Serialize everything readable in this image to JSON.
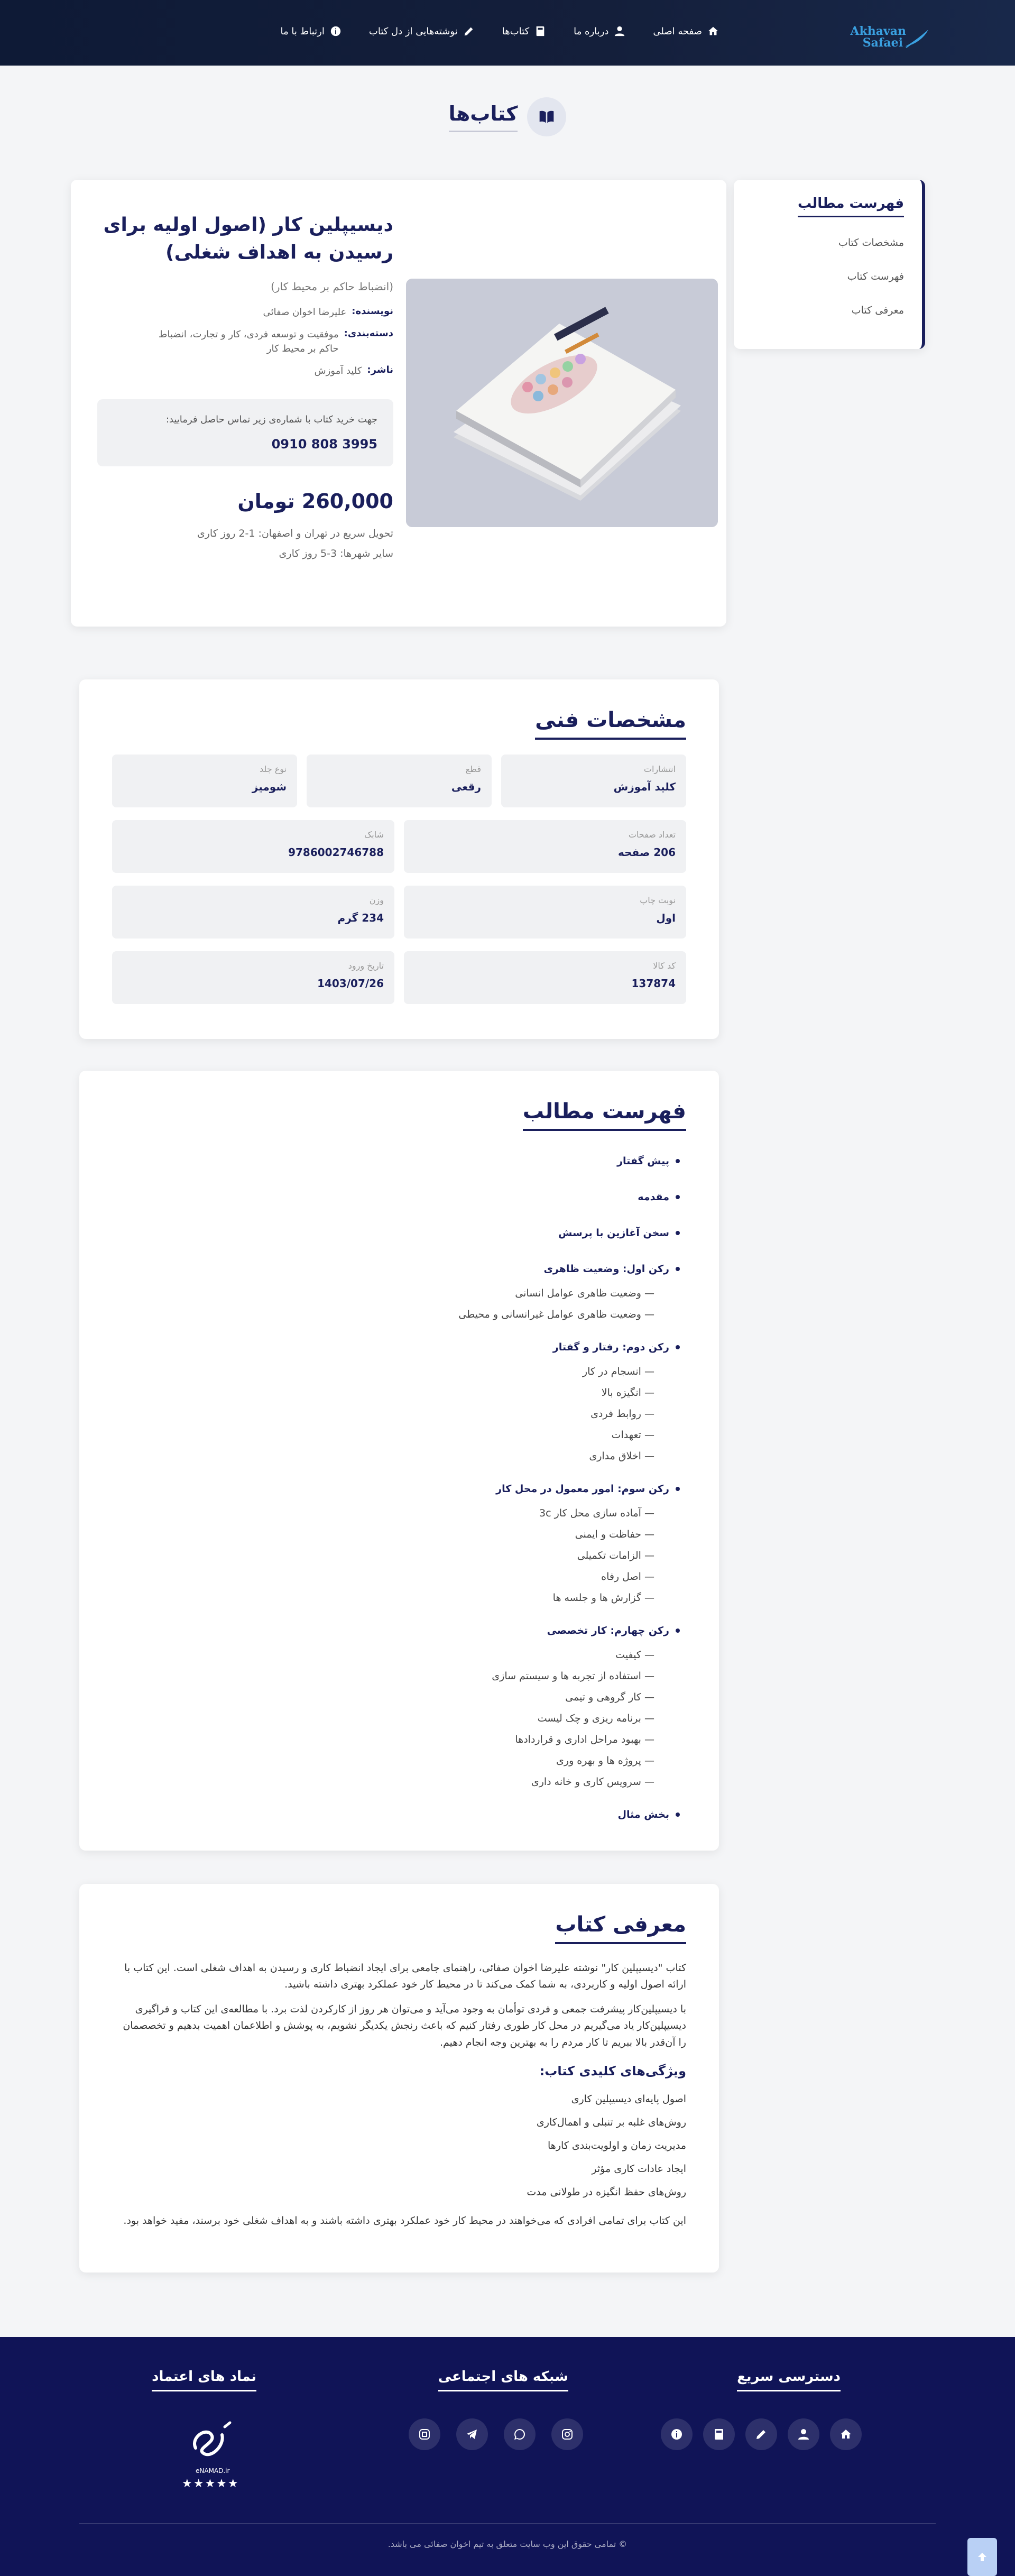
{
  "header": {
    "logo_line1": "Akhavan",
    "logo_line2": "Safaei",
    "nav": [
      {
        "label": "صفحه اصلی",
        "icon": "home-icon"
      },
      {
        "label": "درباره ما",
        "icon": "user-icon"
      },
      {
        "label": "کتاب‌ها",
        "icon": "book-icon"
      },
      {
        "label": "نوشته‌هایی از دل کتاب",
        "icon": "pen-icon"
      },
      {
        "label": "ارتباط با ما",
        "icon": "info-icon"
      }
    ]
  },
  "page_title": "کتاب‌ها",
  "sidebar_toc": {
    "title": "فهرست مطالب",
    "links": [
      "مشخصات کتاب",
      "فهرست کتاب",
      "معرفی کتاب"
    ]
  },
  "book": {
    "title": "دیسیپلین کار (اصول اولیه برای رسیدن به اهداف شغلی)",
    "subtitle": "(انضباط حاکم بر محیط کار)",
    "author_label": "نویسنده:",
    "author": "علیرضا اخوان صفائی",
    "category_label": "دسته‌بندی:",
    "category": "موفقیت و توسعه فردی، کار و تجارت، انضباط حاکم بر محیط کار",
    "publisher_label": "ناشر:",
    "publisher": "کلید آموزش",
    "contact_text": "جهت خرید کتاب با شماره‌ی زیر تماس حاصل فرمایید:",
    "phone": "0910 808 3995",
    "price": "260,000 تومان",
    "delivery_1": "تحویل سریع در تهران و اصفهان: 1-2 روز کاری",
    "delivery_2": "سایر شهرها: 3-5 روز کاری"
  },
  "specs": {
    "title": "مشخصات فنی",
    "items": [
      {
        "label": "انتشارات",
        "value": "کلید آموزش"
      },
      {
        "label": "قطع",
        "value": "رقعی"
      },
      {
        "label": "نوع جلد",
        "value": "شومیز"
      },
      {
        "label": "تعداد صفحات",
        "value": "206 صفحه"
      },
      {
        "label": "شابک",
        "value": "9786002746788"
      },
      {
        "label": "نوبت چاپ",
        "value": "اول"
      },
      {
        "label": "وزن",
        "value": "234 گرم"
      },
      {
        "label": "کد کالا",
        "value": "137874"
      },
      {
        "label": "تاریخ ورود",
        "value": "1403/07/26"
      }
    ]
  },
  "contents": {
    "title": "فهرست مطالب",
    "items": [
      {
        "text": "پیش گفتار",
        "level": 0
      },
      {
        "text": "مقدمه",
        "level": 0
      },
      {
        "text": "سخن آغازین با پرسش",
        "level": 0
      },
      {
        "text": "رکن اول: وضعیت ظاهری",
        "level": 0
      },
      {
        "text": "— وضعیت ظاهری عوامل انسانی",
        "level": 1
      },
      {
        "text": "— وضعیت ظاهری عوامل غیرانسانی و محیطی",
        "level": 1
      },
      {
        "text": "رکن دوم: رفتار و گفتار",
        "level": 0
      },
      {
        "text": "— انسجام در کار",
        "level": 1
      },
      {
        "text": "— انگیزه بالا",
        "level": 1
      },
      {
        "text": "— روابط فردی",
        "level": 1
      },
      {
        "text": "— تعهدات",
        "level": 1
      },
      {
        "text": "— اخلاق مداری",
        "level": 1
      },
      {
        "text": "رکن سوم: امور معمول در محل کار",
        "level": 0
      },
      {
        "text": "— آماده سازی محل کار 3c",
        "level": 1
      },
      {
        "text": "— حفاظت و ایمنی",
        "level": 1
      },
      {
        "text": "— الزامات تکمیلی",
        "level": 1
      },
      {
        "text": "— اصل رفاه",
        "level": 1
      },
      {
        "text": "— گزارش ها و جلسه ها",
        "level": 1
      },
      {
        "text": "رکن چهارم: کار تخصصی",
        "level": 0
      },
      {
        "text": "— کیفیت",
        "level": 1
      },
      {
        "text": "— استفاده از تجربه ها و سیستم سازی",
        "level": 1
      },
      {
        "text": "— کار گروهی و تیمی",
        "level": 1
      },
      {
        "text": "— برنامه ریزی و چک لیست",
        "level": 1
      },
      {
        "text": "— بهبود مراحل اداری و قراردادها",
        "level": 1
      },
      {
        "text": "— پروژه ها و بهره وری",
        "level": 1
      },
      {
        "text": "— سرویس کاری و خانه داری",
        "level": 1
      },
      {
        "text": "بخش مثال",
        "level": 0
      }
    ]
  },
  "intro": {
    "title": "معرفی کتاب",
    "p1": "کتاب \"دیسیپلین کار\" نوشته علیرضا اخوان صفائی، راهنمای جامعی برای ایجاد انضباط کاری و رسیدن به اهداف شغلی است. این کتاب با ارائه اصول اولیه و کاربردی، به شما کمک می‌کند تا در محیط کار خود عملکرد بهتری داشته باشید.",
    "p2": "با دیسیپلین‌کار پیشرفت جمعی و فردی توأمان به وجود می‌آید و می‌توان هر روز از کارکردن لذت برد. با مطالعه‌ی این کتاب و فراگیری دیسیپلین‌کار یاد می‌گیریم در محل کار طوری رفتار کنیم که باعث رنجش یکدیگر نشویم، به پوشش و اطلاعمان اهمیت بدهیم و تخصصمان را آن‌قدر بالا ببریم تا کار مردم را به بهترین وجه انجام دهیم.",
    "features_title": "ویژگی‌های کلیدی کتاب:",
    "features": [
      "اصول پایه‌ای دیسیپلین کاری",
      "روش‌های غلبه بر تنبلی و اهمال‌کاری",
      "مدیریت زمان و اولویت‌بندی کارها",
      "ایجاد عادات کاری مؤثر",
      "روش‌های حفظ انگیزه در طولانی مدت"
    ],
    "closing": "این کتاب برای تمامی افرادی که می‌خواهند در محیط کار خود عملکرد بهتری داشته باشند و به اهداف شغلی خود برسند، مفید خواهد بود."
  },
  "footer": {
    "quick_title": "دسترسی سریع",
    "social_title": "شبکه های اجتماعی",
    "trust_title": "نماد های اعتماد",
    "enamad_text": "eNAMAD.ir",
    "enamad_stars": "★★★★★",
    "copyright": "© تمامی حقوق این وب سایت متعلق به تیم اخوان صفائی می باشد."
  }
}
